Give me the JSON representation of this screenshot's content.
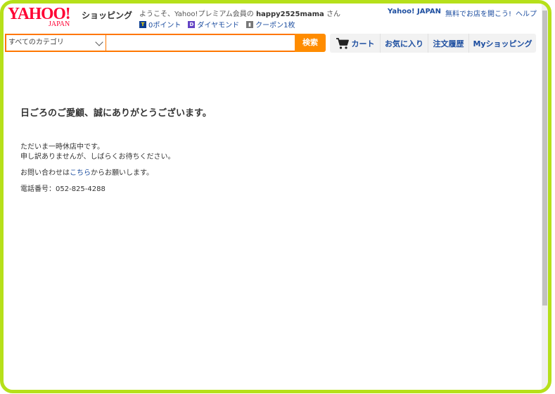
{
  "header": {
    "logo_main": "YAHOO!",
    "logo_sub": "JAPAN",
    "service_name": "ショッピング",
    "welcome_prefix": "ようこそ、Yahoo!プレミアム会員の",
    "username": "happy2525mama",
    "welcome_suffix": "さん",
    "points": [
      {
        "icon": "t-point-icon",
        "glyph": "T",
        "label": "0ポイント"
      },
      {
        "icon": "diamond-icon",
        "glyph": "D",
        "label": "ダイヤモンド"
      },
      {
        "icon": "coupon-icon",
        "glyph": "▮",
        "label": "クーポン1枚"
      }
    ],
    "links": {
      "yahoo_japan": "Yahoo! JAPAN",
      "open_store": "無料でお店を開こう!",
      "help": "ヘルプ"
    }
  },
  "search": {
    "category_value": "すべてのカテゴリ",
    "query_value": "",
    "button_label": "検索"
  },
  "nav": {
    "cart": "カート",
    "favorites": "お気に入り",
    "orders": "注文履歴",
    "my_shopping": "Myショッピング"
  },
  "content": {
    "greeting": "日ごろのご愛顧、誠にありがとうございます。",
    "closed_line1": "ただいま一時休店中です。",
    "closed_line2": "申し訳ありませんが、しばらくお待ちください。",
    "contact_prefix": "お問い合わせは",
    "contact_link": "こちら",
    "contact_suffix": "からお願いします。",
    "phone": "電話番号：052-825-4288"
  },
  "colors": {
    "frame": "#b6e01a",
    "brand_red": "#ff0033",
    "search_orange": "#ff8c00",
    "link_blue": "#1d4ea0"
  }
}
